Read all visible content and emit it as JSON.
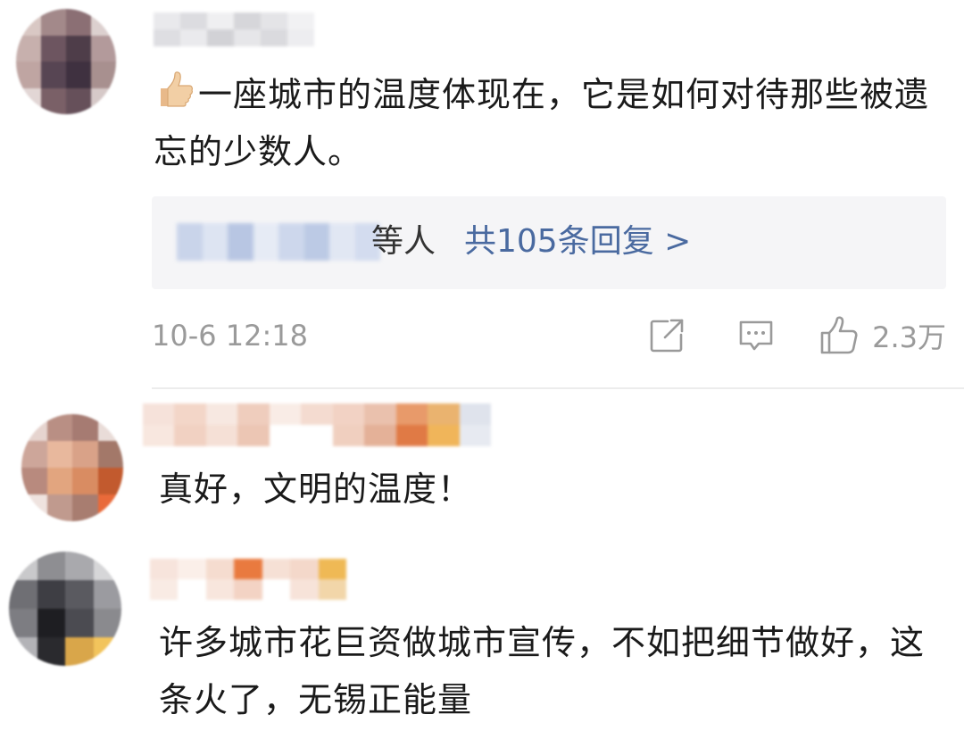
{
  "comments": [
    {
      "author_hidden": true,
      "emoji": "thumbs-up-emoji",
      "text": "一座城市的温度体现在，它是如何对待那些被遗忘的少数人。",
      "replies": {
        "etc_label": "等人",
        "total_label": "共105条回复 >"
      },
      "time": "10-6 12:18",
      "actions": {
        "share_icon": "share-icon",
        "comment_icon": "comment-icon",
        "like_icon": "thumbs-up-icon",
        "like_count": "2.3万"
      }
    },
    {
      "author_hidden": true,
      "text": "真好，文明的温度！"
    },
    {
      "author_hidden": true,
      "text": "许多城市花巨资做城市宣传，不如把细节做好，这条火了，无锡正能量"
    }
  ],
  "colors": {
    "link": "#4a6aa0",
    "meta": "#9a9a9a",
    "reply_bg": "#f5f5f7"
  }
}
